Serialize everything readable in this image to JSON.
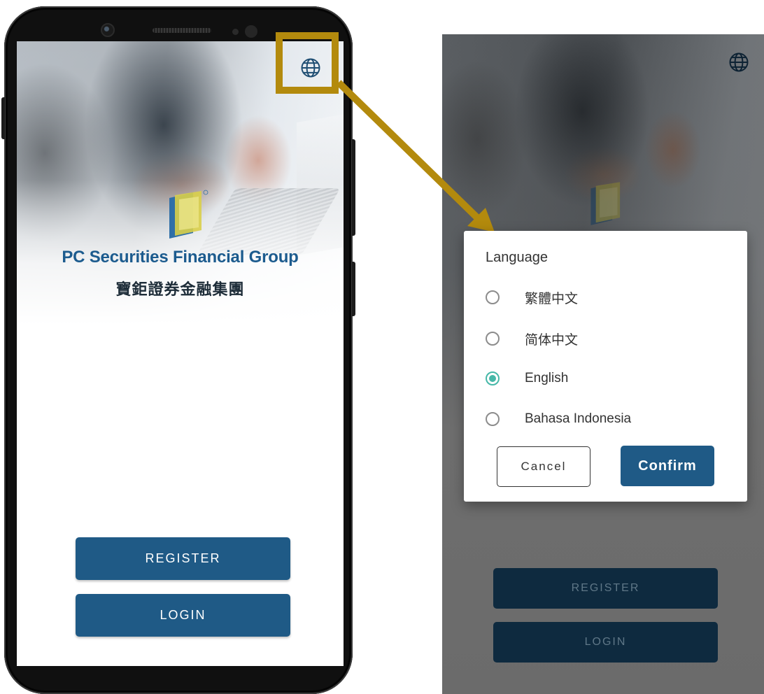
{
  "phone_screen": {
    "brand_name_en": "PC Securities Financial Group",
    "brand_name_zh": "寶鉅證券金融集團",
    "register_label": "REGISTER",
    "login_label": "LOGIN",
    "language_icon": "globe-icon"
  },
  "language_dialog": {
    "title": "Language",
    "options": [
      {
        "label": "繁體中文",
        "selected": false
      },
      {
        "label": "简体中文",
        "selected": false
      },
      {
        "label": "English",
        "selected": true
      },
      {
        "label": "Bahasa Indonesia",
        "selected": false
      }
    ],
    "cancel_label": "Cancel",
    "confirm_label": "Confirm"
  },
  "dimmed_background": {
    "register_label": "REGISTER",
    "login_label": "LOGIN"
  },
  "colors": {
    "primary_button": "#1f5a86",
    "brand_text": "#1c5b8e",
    "callout": "#b38a0d",
    "radio_selected": "#46b8a8"
  }
}
